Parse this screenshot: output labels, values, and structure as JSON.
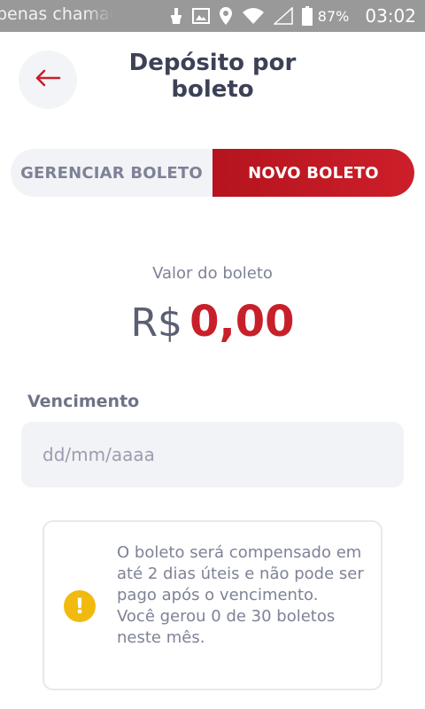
{
  "status_bar": {
    "notification_text": "penas chamada",
    "battery": "87%",
    "time": "03:02",
    "icons": [
      "brush-icon",
      "image-icon",
      "location-pin-icon",
      "wifi-icon",
      "signal-icon",
      "battery-icon"
    ]
  },
  "header": {
    "back_icon": "arrow-left-icon",
    "title": "Depósito por boleto"
  },
  "tabs": [
    {
      "label": "GERENCIAR BOLETO",
      "active": false
    },
    {
      "label": "NOVO BOLETO",
      "active": true
    }
  ],
  "amount": {
    "label": "Valor do boleto",
    "currency": "R$",
    "value": "0,00"
  },
  "due_date": {
    "label": "Vencimento",
    "value": "",
    "placeholder": "dd/mm/aaaa"
  },
  "info": {
    "icon": "warning-icon",
    "line1": "O boleto será compensado em até 2 dias úteis e não pode ser pago após o vencimento.",
    "line2": "Você gerou 0 de 30 boletos neste mês."
  },
  "colors": {
    "accent": "#c8202b",
    "warning": "#f2b90f",
    "status_bar": "#999999"
  }
}
